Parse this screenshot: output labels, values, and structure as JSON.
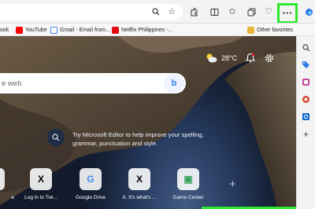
{
  "favorites": [
    {
      "label": "ook",
      "icon": "tab-fragment-icon",
      "color": "#3b5998"
    },
    {
      "label": "YouTube",
      "icon": "youtube-icon",
      "color": "#ff0000"
    },
    {
      "label": "Gmail - Email from...",
      "icon": "google-icon",
      "color": "#4285f4"
    },
    {
      "label": "Netflix Philippines -...",
      "icon": "netflix-icon",
      "color": "#e50914"
    }
  ],
  "other_favorites": "Other favorites",
  "more_button": "···",
  "weather": {
    "temperature": "28°C",
    "icon": "partly-cloudy-icon"
  },
  "search": {
    "placeholder": "e web"
  },
  "bing_label": "b",
  "editor_prompt": "Try Microsoft Editor to help improve your spelling, grammar, punctuation and style.",
  "tiles": [
    {
      "label": "e",
      "glyph": "",
      "name": "tile-partial"
    },
    {
      "label": "Log in to Twi...",
      "glyph": "X",
      "name": "tile-twitter-login"
    },
    {
      "label": "Google Drive",
      "glyph": "G",
      "name": "tile-google-drive"
    },
    {
      "label": "X. It's what's ...",
      "glyph": "X",
      "name": "tile-x"
    },
    {
      "label": "Game Center",
      "glyph": "▣",
      "name": "tile-game-center"
    }
  ],
  "add_tile": "+",
  "accent_colors": {
    "highlight": "#2ee82e",
    "edge_blue": "#2c7be5"
  }
}
